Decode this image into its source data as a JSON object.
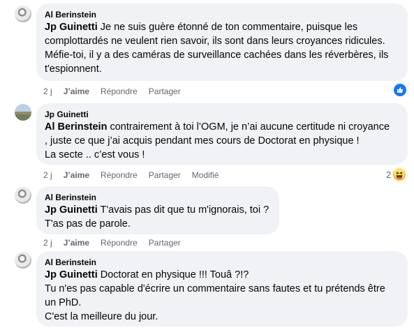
{
  "comments": [
    {
      "author": "Al Berinstein",
      "mention": "Jp Guinetti",
      "lines": [
        " Je ne suis guère étonné de ton commentaire, puisque les",
        "complottardés ne veulent rien savoir, ils sont dans leurs croyances ridicules.",
        "Méfie-toi, il y a des caméras de surveillance cachées dans les réverbères, ils",
        "t'espionnent."
      ],
      "time": "2 j",
      "like": "J’aime",
      "reply": "Répondre",
      "share": "Partager",
      "reaction": "like-reaction-icon"
    },
    {
      "author": "Jp Guinetti",
      "mention": "Al Berinstein",
      "lines": [
        " contrairement à toi l’OGM, je n’ai aucune certitude ni croyance",
        ", juste ce que j’ai acquis pendant mes cours de Doctorat en physique !",
        "La secte .. c’est vous !"
      ],
      "time": "2 j",
      "like": "J’aime",
      "reply": "Répondre",
      "share": "Partager",
      "modified": "Modifié",
      "reaction_count": "2"
    },
    {
      "author": "Al Berinstein",
      "mention": "Jp Guinetti",
      "lines": [
        " T'avais pas dit que tu m'ignorais, toi ?",
        "T'as pas de parole."
      ],
      "time": "2 j",
      "like": "J’aime",
      "reply": "Répondre",
      "share": "Partager"
    },
    {
      "author": "Al Berinstein",
      "mention": "Jp Guinetti",
      "lines": [
        " Doctorat en physique !!! Touâ ?!?",
        "Tu n'es pas capable d'écrire un commentaire sans fautes et tu prétends être",
        "un PhD.",
        "C'est la meilleure du jour."
      ]
    }
  ]
}
